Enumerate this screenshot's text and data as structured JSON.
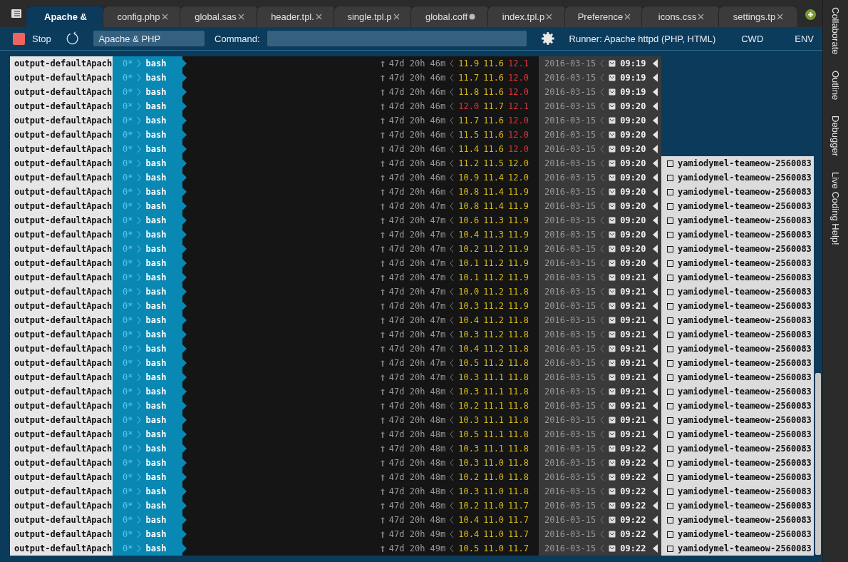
{
  "tabs": [
    {
      "label": "Apache &",
      "selected": true,
      "modified": false
    },
    {
      "label": "config.php",
      "selected": false,
      "modified": false
    },
    {
      "label": "global.sas",
      "selected": false,
      "modified": false
    },
    {
      "label": "header.tpl.",
      "selected": false,
      "modified": false
    },
    {
      "label": "single.tpl.p",
      "selected": false,
      "modified": false
    },
    {
      "label": "global.coff",
      "selected": false,
      "modified": true
    },
    {
      "label": "index.tpl.p",
      "selected": false,
      "modified": false
    },
    {
      "label": "Preference",
      "selected": false,
      "modified": false
    },
    {
      "label": "icons.css",
      "selected": false,
      "modified": false
    },
    {
      "label": "settings.tp",
      "selected": false,
      "modified": false
    }
  ],
  "toolbar": {
    "stop": "Stop",
    "runner_name": "Apache & PHP",
    "command_label": "Command:",
    "runner": "Runner: Apache httpd (PHP, HTML)",
    "cwd": "CWD",
    "env": "ENV"
  },
  "side_panels": [
    "Collaborate",
    "Outline",
    "Debugger",
    "Live Coding Help!"
  ],
  "terminal": {
    "rows": [
      {
        "session": "output-defaultApach",
        "window": "0*",
        "command": "bash",
        "uptime": "47d 20h 46m",
        "loads": [
          {
            "value": "11.9",
            "high": false
          },
          {
            "value": "11.6",
            "high": false
          },
          {
            "value": "12.1",
            "high": true
          }
        ],
        "date": "2016-03-15",
        "time": "09:19"
      },
      {
        "session": "output-defaultApach",
        "window": "0*",
        "command": "bash",
        "uptime": "47d 20h 46m",
        "loads": [
          {
            "value": "11.7",
            "high": false
          },
          {
            "value": "11.6",
            "high": false
          },
          {
            "value": "12.0",
            "high": true
          }
        ],
        "date": "2016-03-15",
        "time": "09:19"
      },
      {
        "session": "output-defaultApach",
        "window": "0*",
        "command": "bash",
        "uptime": "47d 20h 46m",
        "loads": [
          {
            "value": "11.8",
            "high": false
          },
          {
            "value": "11.6",
            "high": false
          },
          {
            "value": "12.0",
            "high": true
          }
        ],
        "date": "2016-03-15",
        "time": "09:19"
      },
      {
        "session": "output-defaultApach",
        "window": "0*",
        "command": "bash",
        "uptime": "47d 20h 46m",
        "loads": [
          {
            "value": "12.0",
            "high": true
          },
          {
            "value": "11.7",
            "high": false
          },
          {
            "value": "12.1",
            "high": true
          }
        ],
        "date": "2016-03-15",
        "time": "09:20"
      },
      {
        "session": "output-defaultApach",
        "window": "0*",
        "command": "bash",
        "uptime": "47d 20h 46m",
        "loads": [
          {
            "value": "11.7",
            "high": false
          },
          {
            "value": "11.6",
            "high": false
          },
          {
            "value": "12.0",
            "high": true
          }
        ],
        "date": "2016-03-15",
        "time": "09:20"
      },
      {
        "session": "output-defaultApach",
        "window": "0*",
        "command": "bash",
        "uptime": "47d 20h 46m",
        "loads": [
          {
            "value": "11.5",
            "high": false
          },
          {
            "value": "11.6",
            "high": false
          },
          {
            "value": "12.0",
            "high": true
          }
        ],
        "date": "2016-03-15",
        "time": "09:20"
      },
      {
        "session": "output-defaultApach",
        "window": "0*",
        "command": "bash",
        "uptime": "47d 20h 46m",
        "loads": [
          {
            "value": "11.4",
            "high": false
          },
          {
            "value": "11.6",
            "high": false
          },
          {
            "value": "12.0",
            "high": true
          }
        ],
        "date": "2016-03-15",
        "time": "09:20"
      },
      {
        "session": "output-defaultApach",
        "window": "0*",
        "command": "bash",
        "uptime": "47d 20h 46m",
        "loads": [
          {
            "value": "11.2",
            "high": false
          },
          {
            "value": "11.5",
            "high": false
          },
          {
            "value": "12.0",
            "high": false
          }
        ],
        "date": "2016-03-15",
        "time": "09:20",
        "host": "yamiodymel-teameow-2560083"
      },
      {
        "session": "output-defaultApach",
        "window": "0*",
        "command": "bash",
        "uptime": "47d 20h 46m",
        "loads": [
          {
            "value": "10.9",
            "high": false
          },
          {
            "value": "11.4",
            "high": false
          },
          {
            "value": "12.0",
            "high": false
          }
        ],
        "date": "2016-03-15",
        "time": "09:20",
        "host": "yamiodymel-teameow-2560083"
      },
      {
        "session": "output-defaultApach",
        "window": "0*",
        "command": "bash",
        "uptime": "47d 20h 46m",
        "loads": [
          {
            "value": "10.8",
            "high": false
          },
          {
            "value": "11.4",
            "high": false
          },
          {
            "value": "11.9",
            "high": false
          }
        ],
        "date": "2016-03-15",
        "time": "09:20",
        "host": "yamiodymel-teameow-2560083"
      },
      {
        "session": "output-defaultApach",
        "window": "0*",
        "command": "bash",
        "uptime": "47d 20h 47m",
        "loads": [
          {
            "value": "10.8",
            "high": false
          },
          {
            "value": "11.4",
            "high": false
          },
          {
            "value": "11.9",
            "high": false
          }
        ],
        "date": "2016-03-15",
        "time": "09:20",
        "host": "yamiodymel-teameow-2560083"
      },
      {
        "session": "output-defaultApach",
        "window": "0*",
        "command": "bash",
        "uptime": "47d 20h 47m",
        "loads": [
          {
            "value": "10.6",
            "high": false
          },
          {
            "value": "11.3",
            "high": false
          },
          {
            "value": "11.9",
            "high": false
          }
        ],
        "date": "2016-03-15",
        "time": "09:20",
        "host": "yamiodymel-teameow-2560083"
      },
      {
        "session": "output-defaultApach",
        "window": "0*",
        "command": "bash",
        "uptime": "47d 20h 47m",
        "loads": [
          {
            "value": "10.4",
            "high": false
          },
          {
            "value": "11.3",
            "high": false
          },
          {
            "value": "11.9",
            "high": false
          }
        ],
        "date": "2016-03-15",
        "time": "09:20",
        "host": "yamiodymel-teameow-2560083"
      },
      {
        "session": "output-defaultApach",
        "window": "0*",
        "command": "bash",
        "uptime": "47d 20h 47m",
        "loads": [
          {
            "value": "10.2",
            "high": false
          },
          {
            "value": "11.2",
            "high": false
          },
          {
            "value": "11.9",
            "high": false
          }
        ],
        "date": "2016-03-15",
        "time": "09:20",
        "host": "yamiodymel-teameow-2560083"
      },
      {
        "session": "output-defaultApach",
        "window": "0*",
        "command": "bash",
        "uptime": "47d 20h 47m",
        "loads": [
          {
            "value": "10.1",
            "high": false
          },
          {
            "value": "11.2",
            "high": false
          },
          {
            "value": "11.9",
            "high": false
          }
        ],
        "date": "2016-03-15",
        "time": "09:20",
        "host": "yamiodymel-teameow-2560083"
      },
      {
        "session": "output-defaultApach",
        "window": "0*",
        "command": "bash",
        "uptime": "47d 20h 47m",
        "loads": [
          {
            "value": "10.1",
            "high": false
          },
          {
            "value": "11.2",
            "high": false
          },
          {
            "value": "11.9",
            "high": false
          }
        ],
        "date": "2016-03-15",
        "time": "09:21",
        "host": "yamiodymel-teameow-2560083"
      },
      {
        "session": "output-defaultApach",
        "window": "0*",
        "command": "bash",
        "uptime": "47d 20h 47m",
        "loads": [
          {
            "value": "10.0",
            "high": false
          },
          {
            "value": "11.2",
            "high": false
          },
          {
            "value": "11.8",
            "high": false
          }
        ],
        "date": "2016-03-15",
        "time": "09:21",
        "host": "yamiodymel-teameow-2560083"
      },
      {
        "session": "output-defaultApach",
        "window": "0*",
        "command": "bash",
        "uptime": "47d 20h 47m",
        "loads": [
          {
            "value": "10.3",
            "high": false
          },
          {
            "value": "11.2",
            "high": false
          },
          {
            "value": "11.9",
            "high": false
          }
        ],
        "date": "2016-03-15",
        "time": "09:21",
        "host": "yamiodymel-teameow-2560083"
      },
      {
        "session": "output-defaultApach",
        "window": "0*",
        "command": "bash",
        "uptime": "47d 20h 47m",
        "loads": [
          {
            "value": "10.4",
            "high": false
          },
          {
            "value": "11.2",
            "high": false
          },
          {
            "value": "11.8",
            "high": false
          }
        ],
        "date": "2016-03-15",
        "time": "09:21",
        "host": "yamiodymel-teameow-2560083"
      },
      {
        "session": "output-defaultApach",
        "window": "0*",
        "command": "bash",
        "uptime": "47d 20h 47m",
        "loads": [
          {
            "value": "10.3",
            "high": false
          },
          {
            "value": "11.2",
            "high": false
          },
          {
            "value": "11.8",
            "high": false
          }
        ],
        "date": "2016-03-15",
        "time": "09:21",
        "host": "yamiodymel-teameow-2560083"
      },
      {
        "session": "output-defaultApach",
        "window": "0*",
        "command": "bash",
        "uptime": "47d 20h 47m",
        "loads": [
          {
            "value": "10.4",
            "high": false
          },
          {
            "value": "11.2",
            "high": false
          },
          {
            "value": "11.8",
            "high": false
          }
        ],
        "date": "2016-03-15",
        "time": "09:21",
        "host": "yamiodymel-teameow-2560083"
      },
      {
        "session": "output-defaultApach",
        "window": "0*",
        "command": "bash",
        "uptime": "47d 20h 47m",
        "loads": [
          {
            "value": "10.5",
            "high": false
          },
          {
            "value": "11.2",
            "high": false
          },
          {
            "value": "11.8",
            "high": false
          }
        ],
        "date": "2016-03-15",
        "time": "09:21",
        "host": "yamiodymel-teameow-2560083"
      },
      {
        "session": "output-defaultApach",
        "window": "0*",
        "command": "bash",
        "uptime": "47d 20h 47m",
        "loads": [
          {
            "value": "10.3",
            "high": false
          },
          {
            "value": "11.1",
            "high": false
          },
          {
            "value": "11.8",
            "high": false
          }
        ],
        "date": "2016-03-15",
        "time": "09:21",
        "host": "yamiodymel-teameow-2560083"
      },
      {
        "session": "output-defaultApach",
        "window": "0*",
        "command": "bash",
        "uptime": "47d 20h 48m",
        "loads": [
          {
            "value": "10.3",
            "high": false
          },
          {
            "value": "11.1",
            "high": false
          },
          {
            "value": "11.8",
            "high": false
          }
        ],
        "date": "2016-03-15",
        "time": "09:21",
        "host": "yamiodymel-teameow-2560083"
      },
      {
        "session": "output-defaultApach",
        "window": "0*",
        "command": "bash",
        "uptime": "47d 20h 48m",
        "loads": [
          {
            "value": "10.2",
            "high": false
          },
          {
            "value": "11.1",
            "high": false
          },
          {
            "value": "11.8",
            "high": false
          }
        ],
        "date": "2016-03-15",
        "time": "09:21",
        "host": "yamiodymel-teameow-2560083"
      },
      {
        "session": "output-defaultApach",
        "window": "0*",
        "command": "bash",
        "uptime": "47d 20h 48m",
        "loads": [
          {
            "value": "10.3",
            "high": false
          },
          {
            "value": "11.1",
            "high": false
          },
          {
            "value": "11.8",
            "high": false
          }
        ],
        "date": "2016-03-15",
        "time": "09:21",
        "host": "yamiodymel-teameow-2560083"
      },
      {
        "session": "output-defaultApach",
        "window": "0*",
        "command": "bash",
        "uptime": "47d 20h 48m",
        "loads": [
          {
            "value": "10.5",
            "high": false
          },
          {
            "value": "11.1",
            "high": false
          },
          {
            "value": "11.8",
            "high": false
          }
        ],
        "date": "2016-03-15",
        "time": "09:21",
        "host": "yamiodymel-teameow-2560083"
      },
      {
        "session": "output-defaultApach",
        "window": "0*",
        "command": "bash",
        "uptime": "47d 20h 48m",
        "loads": [
          {
            "value": "10.3",
            "high": false
          },
          {
            "value": "11.1",
            "high": false
          },
          {
            "value": "11.8",
            "high": false
          }
        ],
        "date": "2016-03-15",
        "time": "09:22",
        "host": "yamiodymel-teameow-2560083"
      },
      {
        "session": "output-defaultApach",
        "window": "0*",
        "command": "bash",
        "uptime": "47d 20h 48m",
        "loads": [
          {
            "value": "10.3",
            "high": false
          },
          {
            "value": "11.0",
            "high": false
          },
          {
            "value": "11.8",
            "high": false
          }
        ],
        "date": "2016-03-15",
        "time": "09:22",
        "host": "yamiodymel-teameow-2560083"
      },
      {
        "session": "output-defaultApach",
        "window": "0*",
        "command": "bash",
        "uptime": "47d 20h 48m",
        "loads": [
          {
            "value": "10.2",
            "high": false
          },
          {
            "value": "11.0",
            "high": false
          },
          {
            "value": "11.8",
            "high": false
          }
        ],
        "date": "2016-03-15",
        "time": "09:22",
        "host": "yamiodymel-teameow-2560083"
      },
      {
        "session": "output-defaultApach",
        "window": "0*",
        "command": "bash",
        "uptime": "47d 20h 48m",
        "loads": [
          {
            "value": "10.3",
            "high": false
          },
          {
            "value": "11.0",
            "high": false
          },
          {
            "value": "11.8",
            "high": false
          }
        ],
        "date": "2016-03-15",
        "time": "09:22",
        "host": "yamiodymel-teameow-2560083"
      },
      {
        "session": "output-defaultApach",
        "window": "0*",
        "command": "bash",
        "uptime": "47d 20h 48m",
        "loads": [
          {
            "value": "10.2",
            "high": false
          },
          {
            "value": "11.0",
            "high": false
          },
          {
            "value": "11.7",
            "high": false
          }
        ],
        "date": "2016-03-15",
        "time": "09:22",
        "host": "yamiodymel-teameow-2560083"
      },
      {
        "session": "output-defaultApach",
        "window": "0*",
        "command": "bash",
        "uptime": "47d 20h 48m",
        "loads": [
          {
            "value": "10.4",
            "high": false
          },
          {
            "value": "11.0",
            "high": false
          },
          {
            "value": "11.7",
            "high": false
          }
        ],
        "date": "2016-03-15",
        "time": "09:22",
        "host": "yamiodymel-teameow-2560083"
      },
      {
        "session": "output-defaultApach",
        "window": "0*",
        "command": "bash",
        "uptime": "47d 20h 49m",
        "loads": [
          {
            "value": "10.4",
            "high": false
          },
          {
            "value": "11.0",
            "high": false
          },
          {
            "value": "11.7",
            "high": false
          }
        ],
        "date": "2016-03-15",
        "time": "09:22",
        "host": "yamiodymel-teameow-2560083"
      },
      {
        "session": "output-defaultApach",
        "window": "0*",
        "command": "bash",
        "uptime": "47d 20h 49m",
        "loads": [
          {
            "value": "10.5",
            "high": false
          },
          {
            "value": "11.0",
            "high": false
          },
          {
            "value": "11.7",
            "high": false
          }
        ],
        "date": "2016-03-15",
        "time": "09:22",
        "host": "yamiodymel-teameow-2560083"
      }
    ]
  }
}
